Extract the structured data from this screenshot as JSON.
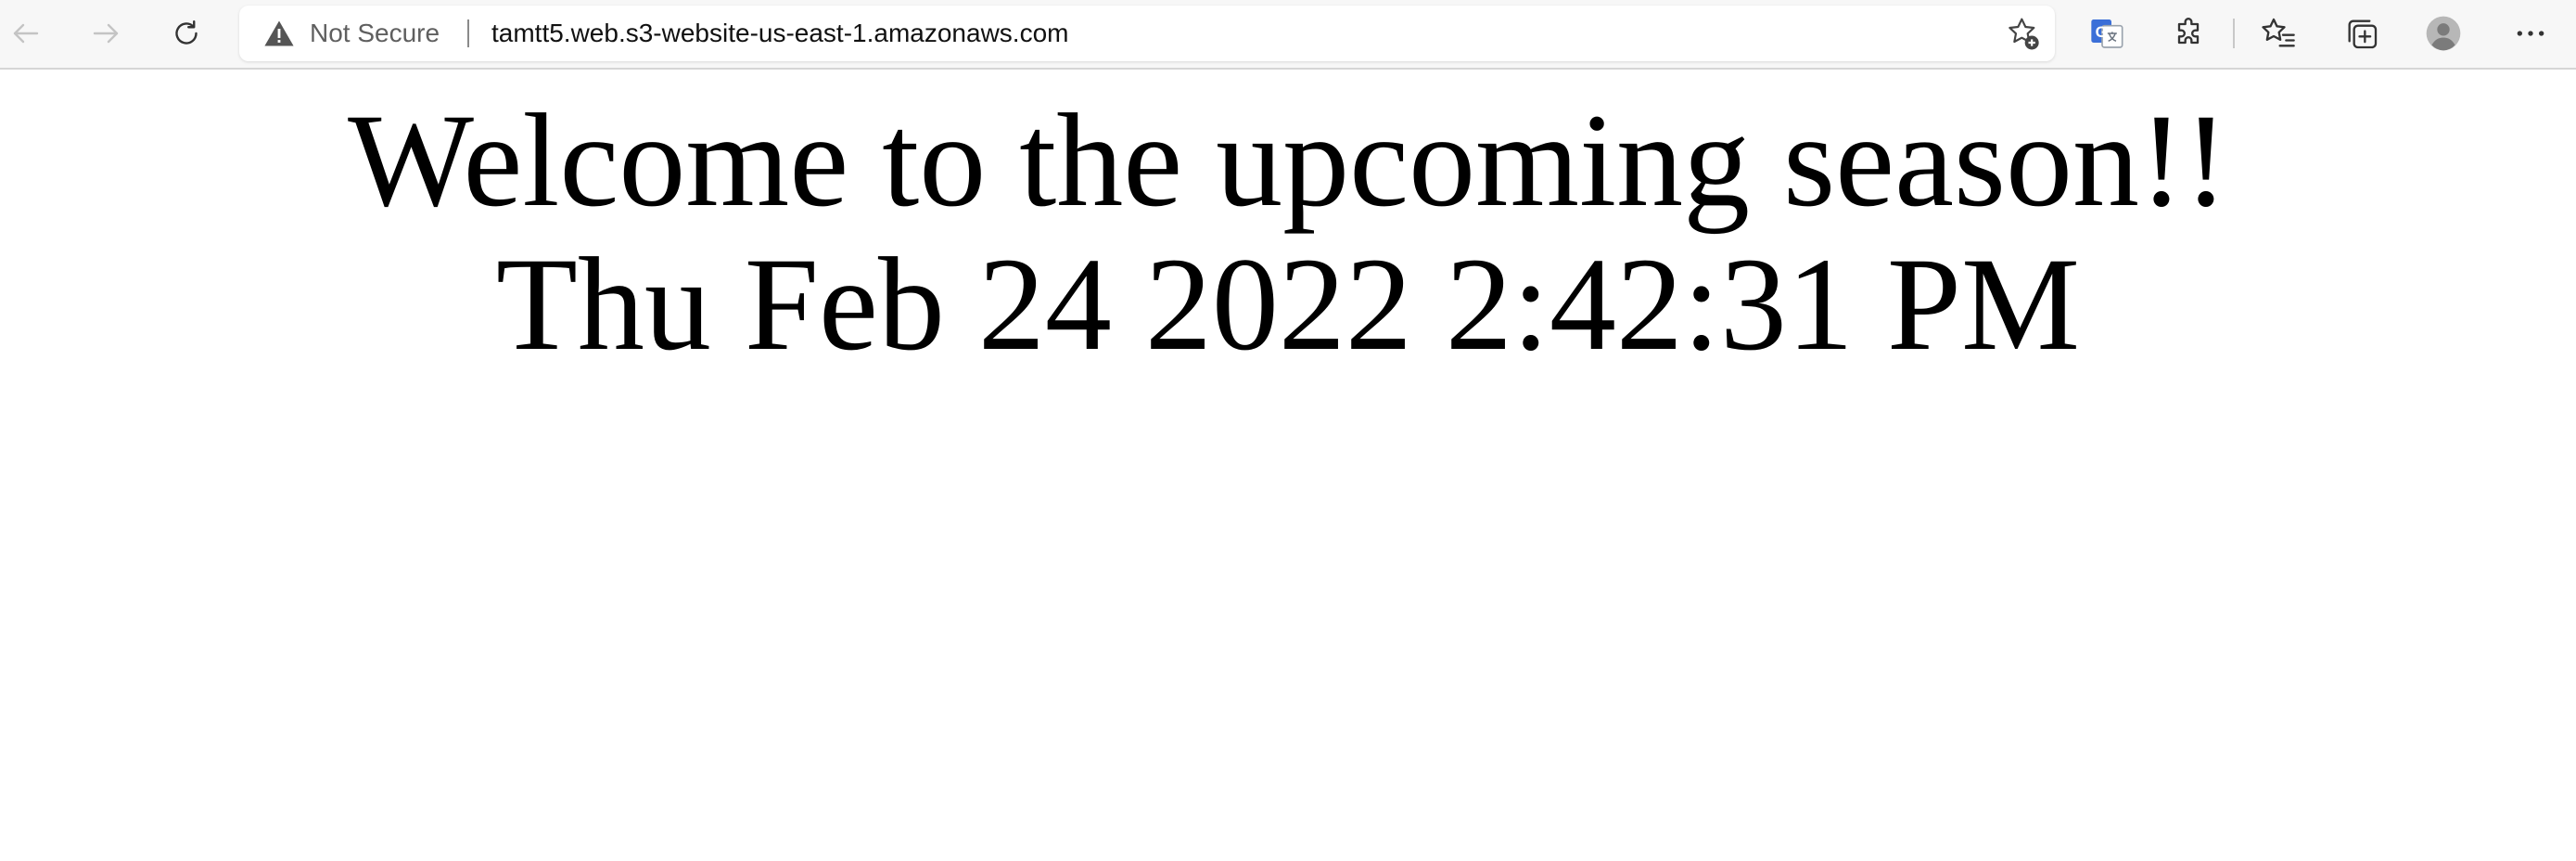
{
  "browser": {
    "security_label": "Not Secure",
    "url": "tamtt5.web.s3-website-us-east-1.amazonaws.com",
    "icons": {
      "back": "back-arrow-icon",
      "forward": "forward-arrow-icon",
      "refresh": "refresh-icon",
      "warning": "warning-icon",
      "add_favorite": "star-add-icon",
      "translate": "translate-icon",
      "extensions": "puzzle-icon",
      "favorites": "favorites-icon",
      "collections": "collections-icon",
      "profile": "avatar-icon",
      "menu": "more-icon"
    },
    "colors": {
      "toolbar_bg": "#f7f7f7",
      "translate_blue": "#3b6fd8"
    }
  },
  "page": {
    "heading": "Welcome to the upcoming season!!",
    "datetime": "Thu Feb 24 2022 2:42:31 PM"
  }
}
